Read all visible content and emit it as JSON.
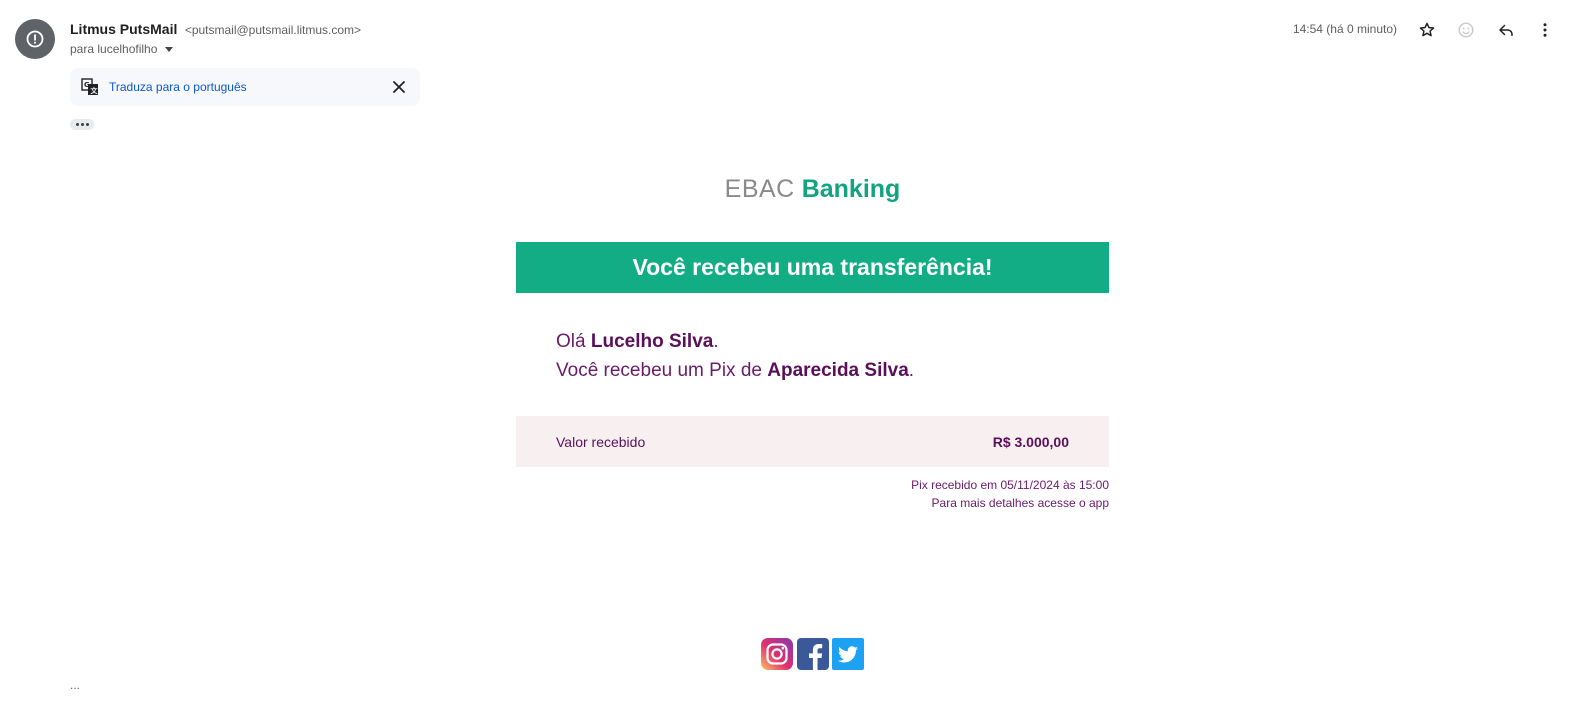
{
  "header": {
    "sender_name": "Litmus PutsMail",
    "sender_email": "<putsmail@putsmail.litmus.com>",
    "recipient": "para lucelhofilho",
    "time": "14:54 (há 0 minuto)",
    "icons": [
      "warning-avatar-icon",
      "star-icon",
      "emoji-icon",
      "reply-icon",
      "more-vert-icon"
    ]
  },
  "translate": {
    "label": "Traduza para o português",
    "icon": "translate-icon"
  },
  "email": {
    "logo_light": "EBAC",
    "logo_bold": "Banking",
    "banner": "Você recebeu uma transferência!",
    "greeting_prefix": "Olá ",
    "greeting_name": "Lucelho Silva",
    "greeting_suffix": ".",
    "pix_prefix": "Você recebeu um Pix de ",
    "pix_sender": "Aparecida Silva",
    "pix_suffix": ".",
    "amount_label": "Valor recebido",
    "amount_value": "R$ 3.000,00",
    "received_note": "Pix recebido em 05/11/2024 às 15:00",
    "details_note": "Para mais detalhes acesse o app",
    "social": [
      "instagram-icon",
      "facebook-icon",
      "twitter-icon"
    ]
  },
  "footer": {
    "trailing": "..."
  },
  "colors": {
    "brand_green": "#12ad84",
    "purple_text": "#5a0f5a",
    "amount_bg": "#f8f0f0",
    "link_blue": "#0b57d0"
  }
}
